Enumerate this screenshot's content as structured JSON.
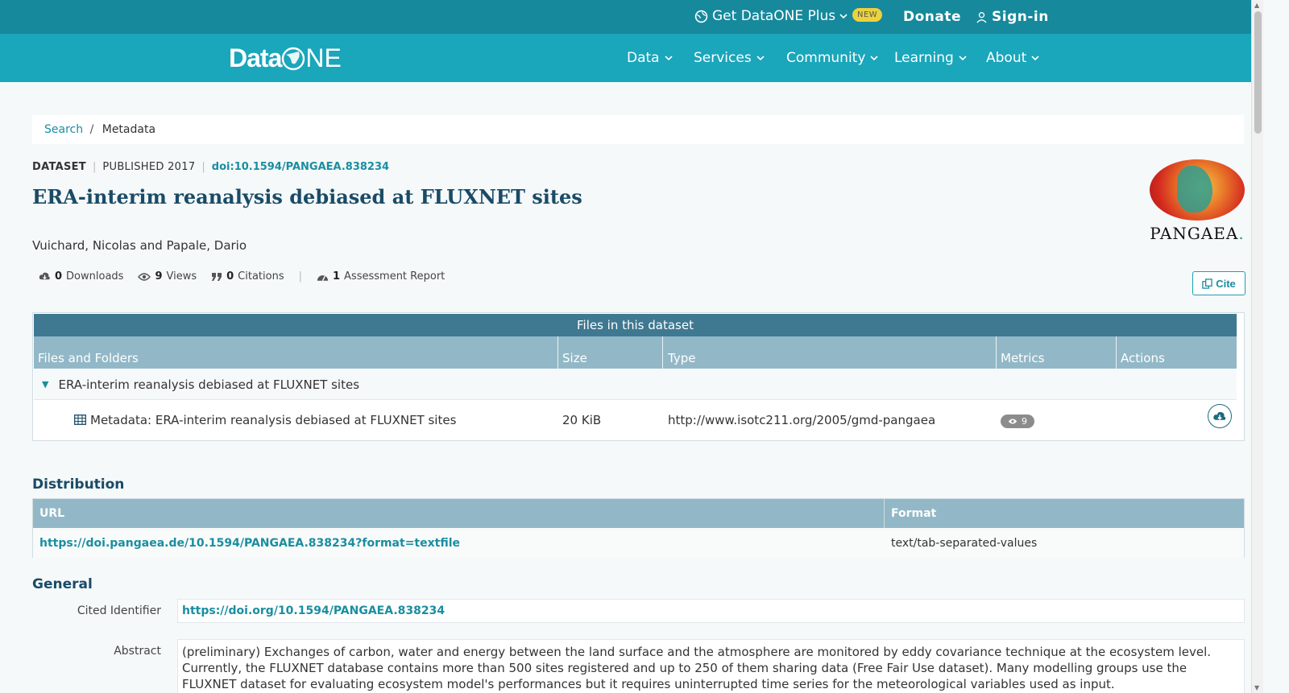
{
  "topbar": {
    "plus_label": "Get DataONE Plus",
    "new_badge": "NEW",
    "donate": "Donate",
    "signin": "Sign-in"
  },
  "nav": {
    "logo_a": "Data",
    "logo_b": "NE",
    "items": [
      "Data",
      "Services",
      "Community",
      "Learning",
      "About"
    ]
  },
  "breadcrumb": {
    "search": "Search",
    "separator": "/",
    "current": "Metadata"
  },
  "dataset": {
    "type_label": "DATASET",
    "published": "PUBLISHED 2017",
    "doi": "doi:10.1594/PANGAEA.838234",
    "title": "ERA-interim reanalysis debiased at FLUXNET sites",
    "authors": "Vuichard, Nicolas and Papale, Dario",
    "repository_name": "PANGAEA",
    "repository_dot": "."
  },
  "metrics": {
    "downloads_count": "0",
    "downloads_label": "Downloads",
    "views_count": "9",
    "views_label": "Views",
    "citations_count": "0",
    "citations_label": "Citations",
    "assessment_count": "1",
    "assessment_label": "Assessment Report",
    "cite_label": "Cite"
  },
  "files": {
    "caption": "Files in this dataset",
    "headers": [
      "Files and Folders",
      "Size",
      "Type",
      "Metrics",
      "Actions"
    ],
    "folder_name": "ERA-interim reanalysis debiased at FLUXNET sites",
    "row": {
      "name": "Metadata: ERA-interim reanalysis debiased at FLUXNET sites",
      "size": "20 KiB",
      "type": "http://www.isotc211.org/2005/gmd-pangaea",
      "views": "9"
    }
  },
  "distribution": {
    "heading": "Distribution",
    "url_header": "URL",
    "format_header": "Format",
    "url": "https://doi.pangaea.de/10.1594/PANGAEA.838234?format=textfile",
    "format": "text/tab-separated-values"
  },
  "general": {
    "heading": "General",
    "cited_label": "Cited Identifier",
    "cited_value": "https://doi.org/10.1594/PANGAEA.838234",
    "abstract_label": "Abstract",
    "abstract": "(preliminary) Exchanges of carbon, water and energy between the land surface and the atmosphere are monitored by eddy covariance technique at the ecosystem level. Currently, the FLUXNET database contains more than 500 sites registered and up to 250 of them sharing data (Free Fair Use dataset). Many modelling groups use the FLUXNET dataset for evaluating ecosystem model's performances but it requires uninterrupted time series for the meteorological variables used as input."
  },
  "colors": {
    "topbar": "#16899c",
    "navbar": "#1aa6bb",
    "link": "#1a8ea0",
    "title": "#1a4b66",
    "table_caption": "#3f7891",
    "table_header": "#92b8c7",
    "new_badge": "#ecd23c"
  }
}
